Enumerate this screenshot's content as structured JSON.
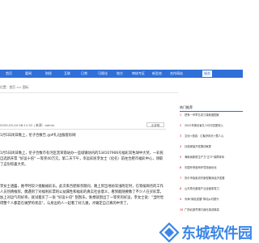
{
  "nav": {
    "items": [
      {
        "label": "首页"
      },
      {
        "label": "要闻"
      },
      {
        "label": "财经"
      },
      {
        "label": "互联"
      },
      {
        "label": "日常"
      },
      {
        "label": "可视化"
      },
      {
        "label": "地方"
      },
      {
        "label": "审核专区"
      },
      {
        "label": "新型态"
      },
      {
        "label": "合作网站"
      },
      {
        "label": "服务"
      }
    ],
    "active_index": 10
  },
  "breadcrumb": "位置：首页 >> 国际",
  "article": {
    "meta": "2025-05-04 08:11:52 | 来源：admin",
    "font_button": "小字号",
    "paragraphs": [
      "1月5日闭日晚上，伦子合数告 @#礼/边服客形网",
      "1月5日闭日晚上，伦子合数市有河区黑荣南站办一些城镇坊内的534107906号福彩双色球中大奖，一彩民自选新开票 \"好运十倍\" 一等奖40万元。第二天下午，幸运彩民李女士（化名）前往合肥市福彩中心，领取了这份惊喜大奖。",
      "李女士透露，她平时较少接触福彩乐。此次来合肥探亲期间，路上到当地坊深浅附近时，在等候网点的工作人员热情推荐，偶遇到了对福利彩票的公益属性和福彩的真实社会意义，看到能随要数了不少人在买彩票，加上对运气的好奇，就试着买了一张 \"好运十倍\" 刮刮乐，谁想就刮出了一等奖的好运，李女士说：\"当时觉得整个人都是在做梦的状态\"，与身边的人一起看了好几遍，才确定自己真的中奖了。"
    ]
  },
  "sidebar": {
    "title": "热门推荐",
    "items": [
      {
        "num": "1",
        "text": "把有一市早孔初订量新度国家"
      },
      {
        "num": "2",
        "text": "2022年湖北省孔人均可支配收入"
      },
      {
        "num": "3",
        "text": "文化+旅游：汇聚好风光+惹人心"
      },
      {
        "num": "4",
        "text": "社保家装开发展动家居"
      },
      {
        "num": "5",
        "text": "海南省新质生产力\"正义\"保障体系"
      },
      {
        "num": "6",
        "text": "中国外贸营商环境持续优化"
      },
      {
        "num": "7",
        "text": "鲁中市探索农村新型集体经济发展"
      },
      {
        "num": "8",
        "text": "山东寿光蔬菜产业全链条发力"
      },
      {
        "num": "9",
        "text": "青海\"绿色发展\"带动乡村振兴"
      },
      {
        "num": "10",
        "text": "广西北部湾港口吞吐量创新高"
      }
    ]
  },
  "watermark": {
    "text": "东城软件园",
    "color": "#3d86e6"
  }
}
